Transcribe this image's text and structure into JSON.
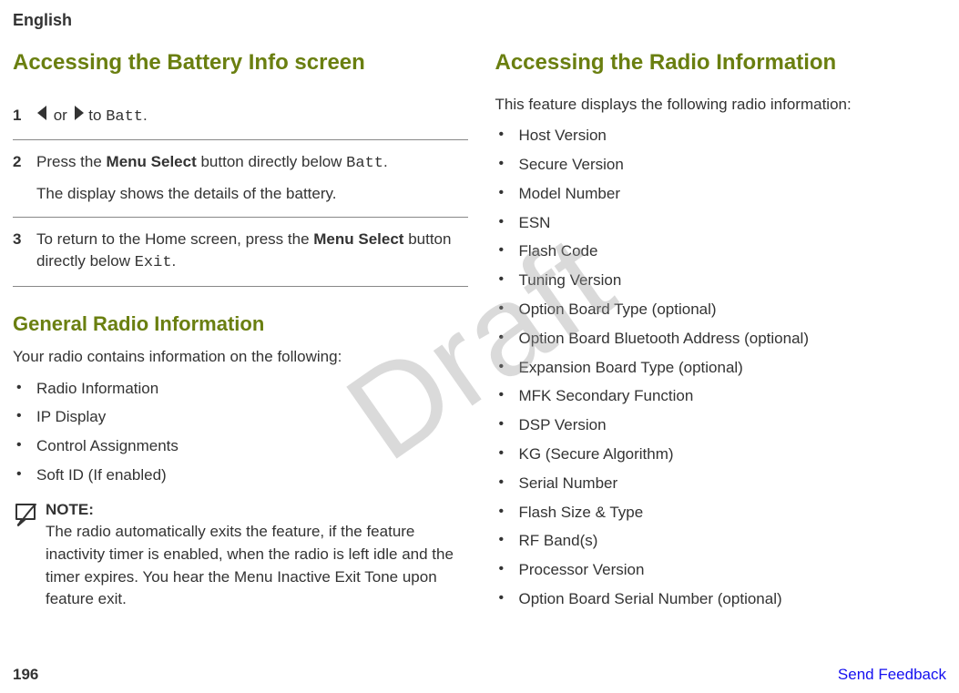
{
  "header": {
    "language": "English"
  },
  "watermark": "Draft",
  "left": {
    "h1": "Accessing the Battery Info screen",
    "steps": {
      "s1_num": "1",
      "s1_or": " or ",
      "s1_to": " to ",
      "s1_batt": "Batt",
      "s1_dot": ".",
      "s2_num": "2",
      "s2_p1a": "Press the ",
      "s2_p1b": "Menu Select",
      "s2_p1c": " button directly below ",
      "s2_p1d": "Batt",
      "s2_p1e": ".",
      "s2_p2": "The display shows the details of the battery.",
      "s3_num": "3",
      "s3_p1a": "To return to the Home screen, press the ",
      "s3_p1b": "Menu Select",
      "s3_p1c": " button directly below ",
      "s3_p1d": "Exit",
      "s3_p1e": "."
    },
    "h2": "General Radio Information",
    "intro": "Your radio contains information on the following:",
    "items": [
      "Radio Information",
      "IP Display",
      "Control Assignments",
      "Soft ID (If enabled)"
    ],
    "note_title": "NOTE:",
    "note_body": "The radio automatically exits the feature, if the feature inactivity timer is enabled, when the radio is left idle and the timer expires. You hear the Menu Inactive Exit Tone upon feature exit."
  },
  "right": {
    "h1": "Accessing the Radio Information",
    "intro": "This feature displays the following radio information:",
    "items": [
      "Host Version",
      "Secure Version",
      "Model Number",
      "ESN",
      "Flash Code",
      "Tuning Version",
      "Option Board Type (optional)",
      "Option Board Bluetooth Address (optional)",
      "Expansion Board Type (optional)",
      "MFK Secondary Function",
      "DSP Version",
      "KG (Secure Algorithm)",
      "Serial Number",
      "Flash Size & Type",
      "RF Band(s)",
      "Processor Version",
      "Option Board Serial Number (optional)"
    ]
  },
  "footer": {
    "page_number": "196",
    "feedback": "Send Feedback"
  }
}
